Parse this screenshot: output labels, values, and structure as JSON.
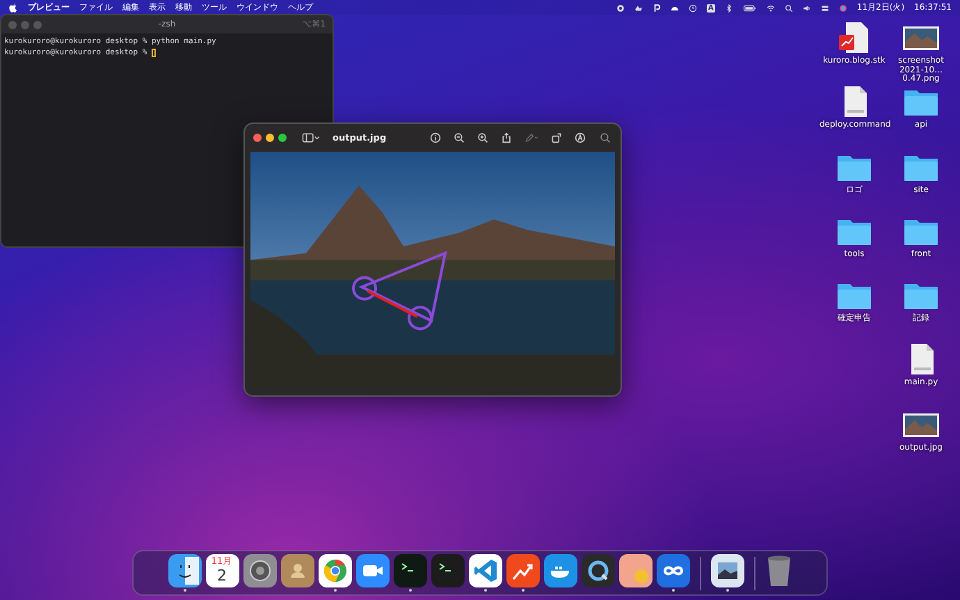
{
  "menu_bar": {
    "app_name": "プレビュー",
    "menus": [
      "ファイル",
      "編集",
      "表示",
      "移動",
      "ツール",
      "ウインドウ",
      "ヘルプ"
    ],
    "input_source": "A",
    "date": "11月2日(火)",
    "time": "16:37:51"
  },
  "terminal": {
    "title": "-zsh",
    "shortcut": "⌥⌘1",
    "lines": [
      "kurokuroro@kurokuroro desktop % python main.py",
      "kurokuroro@kurokuroro desktop % "
    ]
  },
  "preview": {
    "title": "output.jpg"
  },
  "desktop_icons": [
    {
      "label": "kuroro.blog.stk",
      "kind": "stk"
    },
    {
      "label": "screenshot 2021-10…0.47.png",
      "kind": "image"
    },
    {
      "label": "deploy.command",
      "kind": "shell"
    },
    {
      "label": "api",
      "kind": "folder"
    },
    {
      "label": "ロゴ",
      "kind": "folder"
    },
    {
      "label": "site",
      "kind": "folder"
    },
    {
      "label": "tools",
      "kind": "folder"
    },
    {
      "label": "front",
      "kind": "folder"
    },
    {
      "label": "確定申告",
      "kind": "folder"
    },
    {
      "label": "記録",
      "kind": "folder"
    },
    {
      "label": "main.py",
      "kind": "python"
    },
    {
      "label": "output.jpg",
      "kind": "image"
    }
  ],
  "dock": {
    "apps": [
      {
        "kind": "finder",
        "running": true
      },
      {
        "kind": "calendar",
        "running": false,
        "month": "11月",
        "day": "2"
      },
      {
        "kind": "settings",
        "running": false
      },
      {
        "kind": "contacts",
        "running": false
      },
      {
        "kind": "chrome",
        "running": true
      },
      {
        "kind": "video",
        "running": false
      },
      {
        "kind": "iterm",
        "running": true
      },
      {
        "kind": "terminal",
        "running": false
      },
      {
        "kind": "vscode",
        "running": true
      },
      {
        "kind": "chart",
        "running": true
      },
      {
        "kind": "whale",
        "running": false
      },
      {
        "kind": "quicktime",
        "running": false
      },
      {
        "kind": "pill",
        "running": false
      },
      {
        "kind": "infinity",
        "running": true
      }
    ],
    "recent": [
      {
        "kind": "preview",
        "running": true
      }
    ],
    "trash": {
      "running": false
    }
  }
}
